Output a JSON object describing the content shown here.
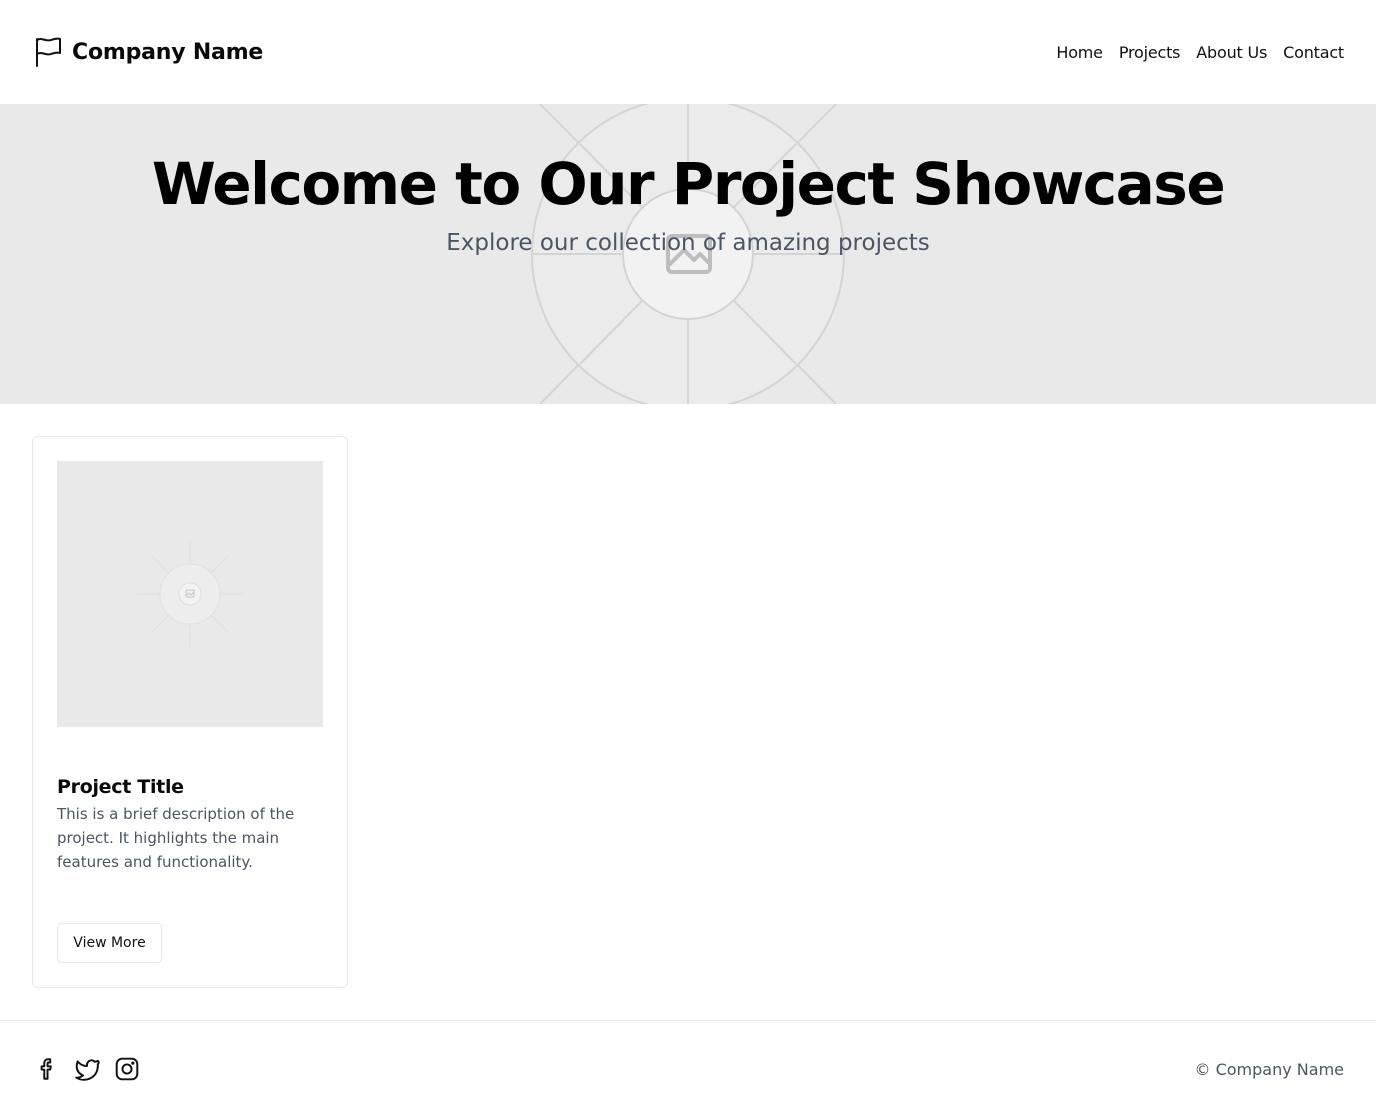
{
  "header": {
    "brand_name": "Company Name",
    "brand_icon": "flag-icon",
    "nav": [
      {
        "label": "Home"
      },
      {
        "label": "Projects"
      },
      {
        "label": "About Us"
      },
      {
        "label": "Contact"
      }
    ]
  },
  "hero": {
    "title": "Welcome to Our Project Showcase",
    "subtitle": "Explore our collection of amazing projects",
    "background_icon": "image-placeholder-icon"
  },
  "projects": [
    {
      "title": "Project Title",
      "description": "This is a brief description of the project. It highlights the main features and functionality.",
      "button_label": "View More",
      "image_icon": "image-placeholder-icon"
    }
  ],
  "footer": {
    "socials": [
      {
        "icon": "facebook-icon"
      },
      {
        "icon": "twitter-icon"
      },
      {
        "icon": "instagram-icon"
      }
    ],
    "copyright": "© Company Name"
  },
  "colors": {
    "placeholder_bg": "#e9e9e9",
    "text_muted": "#4b5563",
    "border": "#e5e7eb"
  }
}
